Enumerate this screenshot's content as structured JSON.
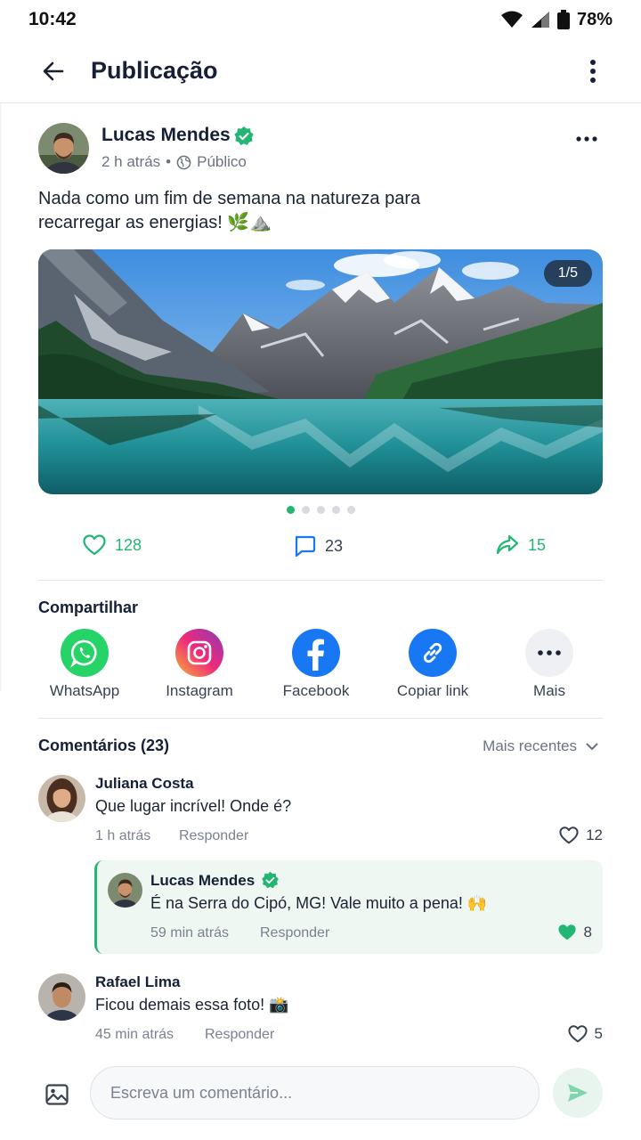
{
  "status_bar": {
    "time": "10:42",
    "battery": "78%"
  },
  "app_bar": {
    "title": "Publicação"
  },
  "post": {
    "author": "Lucas Mendes",
    "time": "2 h atrás",
    "separator": "•",
    "visibility": "Público",
    "text_line1": "Nada como um fim de semana na natureza para",
    "text_line2": "recarregar as energias! 🌿⛰️",
    "image_counter": "1/5",
    "image_index": 1,
    "image_total": 5,
    "likes": "128",
    "comments": "23",
    "shares": "15"
  },
  "share": {
    "title": "Compartilhar",
    "items": [
      {
        "label": "WhatsApp",
        "icon": "whatsapp-icon",
        "color": "#25D366"
      },
      {
        "label": "Instagram",
        "icon": "instagram-icon",
        "color": "#d6249f"
      },
      {
        "label": "Facebook",
        "icon": "facebook-icon",
        "color": "#1877F2"
      },
      {
        "label": "Copiar link",
        "icon": "link-icon",
        "color": "#1877F2"
      },
      {
        "label": "Mais",
        "icon": "more-icon",
        "color": "#eef0f3"
      }
    ]
  },
  "comments": {
    "title": "Comentários (23)",
    "sort_label": "Mais recentes",
    "items": [
      {
        "name": "Juliana Costa",
        "text": "Que lugar incrível! Onde é?",
        "time": "1 h atrás",
        "reply_label": "Responder",
        "likes": "12",
        "liked": false
      },
      {
        "name": "Lucas Mendes",
        "text": "É na Serra do Cipó, MG! Vale muito a pena! 🙌",
        "time": "59 min atrás",
        "reply_label": "Responder",
        "likes": "8",
        "liked": true
      },
      {
        "name": "Rafael Lima",
        "text": "Ficou demais essa foto! 📸",
        "time": "45 min atrás",
        "reply_label": "Responder",
        "likes": "5",
        "liked": false
      }
    ]
  },
  "composer": {
    "placeholder": "Escreva um comentário..."
  },
  "colors": {
    "accent": "#22b573",
    "comment_icon": "#1877F2",
    "text": "#152036"
  }
}
